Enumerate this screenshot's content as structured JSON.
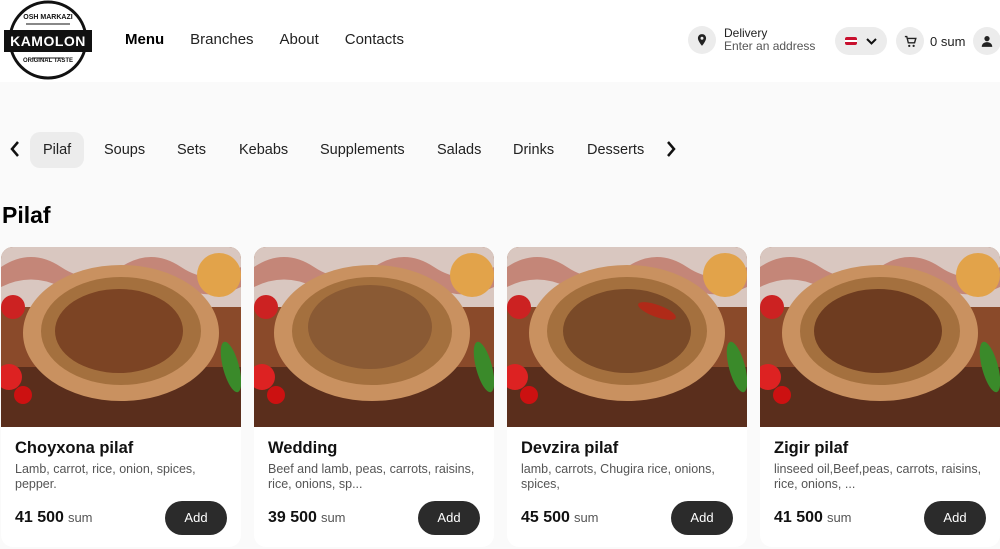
{
  "logo": {
    "top": "OSH MARKAZI",
    "main": "KAMOLON",
    "bottom": "ORIGINAL TASTE"
  },
  "nav": [
    {
      "label": "Menu"
    },
    {
      "label": "Branches"
    },
    {
      "label": "About"
    },
    {
      "label": "Contacts"
    }
  ],
  "delivery": {
    "title": "Delivery",
    "subtitle": "Enter an address"
  },
  "cart": {
    "total": "0 sum"
  },
  "categories": [
    {
      "label": "Pilaf"
    },
    {
      "label": "Soups"
    },
    {
      "label": "Sets"
    },
    {
      "label": "Kebabs"
    },
    {
      "label": "Supplements"
    },
    {
      "label": "Salads"
    },
    {
      "label": "Drinks"
    },
    {
      "label": "Desserts"
    }
  ],
  "section": {
    "title": "Pilaf"
  },
  "products": [
    {
      "name": "Choyxona pilaf",
      "desc": "Lamb, carrot, rice, onion, spices, pepper.",
      "price": "41 500",
      "currency": "sum",
      "button": "Add"
    },
    {
      "name": "Wedding",
      "desc": "Beef and lamb, peas, carrots, raisins, rice, onions, sp...",
      "price": "39 500",
      "currency": "sum",
      "button": "Add"
    },
    {
      "name": "Devzira pilaf",
      "desc": "lamb, carrots, Chugira rice, onions, spices,",
      "price": "45 500",
      "currency": "sum",
      "button": "Add"
    },
    {
      "name": "Zigir pilaf",
      "desc": "linseed oil,Beef,peas, carrots, raisins, rice, onions, ...",
      "price": "41 500",
      "currency": "sum",
      "button": "Add"
    }
  ],
  "colors": {
    "accent": "#2b2b2b",
    "pill": "#ececec",
    "background": "#fafafa"
  }
}
